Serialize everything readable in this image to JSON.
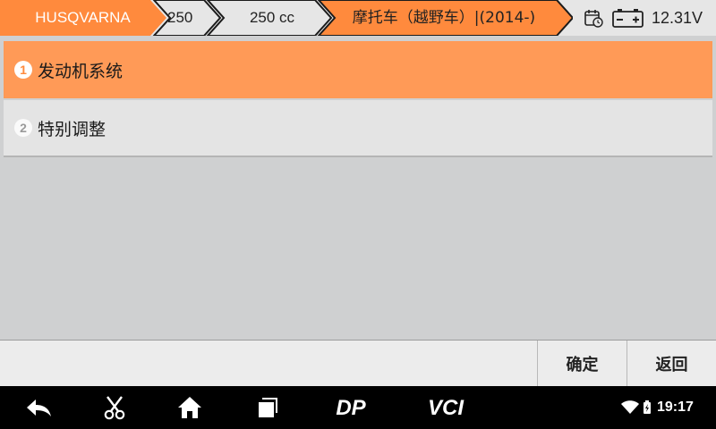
{
  "header": {
    "breadcrumbs": [
      {
        "label": "HUSQVARNA"
      },
      {
        "label": "250"
      },
      {
        "label": "250 cc"
      },
      {
        "label": "摩托车（越野车）|(2014-)"
      }
    ],
    "voltage": "12.31V",
    "colors": {
      "active_crumb": "#ff8a3d",
      "inactive_crumb": "#e6e6e6"
    }
  },
  "menu": {
    "items": [
      {
        "number": "1",
        "label": "发动机系统",
        "selected": true
      },
      {
        "number": "2",
        "label": "特别调整",
        "selected": false
      }
    ],
    "colors": {
      "selected": "#ff9a57",
      "unselected": "#e4e4e4"
    }
  },
  "actions": {
    "confirm_label": "确定",
    "back_label": "返回"
  },
  "navbar": {
    "icons": [
      "back-arrow-icon",
      "scissors-icon",
      "home-icon",
      "recents-icon",
      "dp-logo-icon",
      "vci-logo-icon"
    ],
    "dp_label": "DP",
    "vci_label": "VCI",
    "time": "19:17"
  }
}
